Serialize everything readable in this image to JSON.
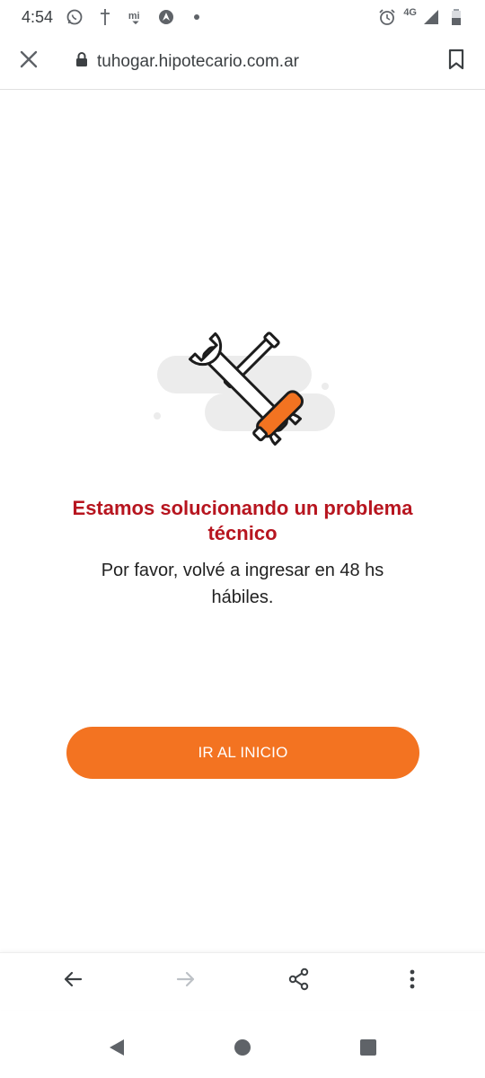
{
  "status_bar": {
    "time": "4:54",
    "icons": [
      "whatsapp-icon",
      "cross-icon",
      "mi-icon",
      "compass-icon",
      "dot-icon"
    ],
    "right_icons": [
      "alarm-icon",
      "signal-icon",
      "battery-icon"
    ],
    "network": "4G"
  },
  "toolbar": {
    "url": "tuhogar.hipotecario.com.ar",
    "close_icon": "close-icon",
    "lock_icon": "lock-icon",
    "bookmark_icon": "bookmark-icon"
  },
  "content": {
    "title": "Estamos solucionando un problema técnico",
    "message": "Por favor, volvé a ingresar en 48 hs hábiles.",
    "button_label": "IR AL INICIO",
    "illustration": "tools-icon"
  },
  "colors": {
    "accent": "#f37321",
    "title_red": "#b7151f",
    "illustration_bg": "#ececec"
  },
  "bottom_bar": {
    "icons": [
      "back-arrow-icon",
      "forward-arrow-icon",
      "share-icon",
      "more-icon"
    ]
  },
  "nav_bar": {
    "icons": [
      "nav-back-icon",
      "nav-home-icon",
      "nav-recents-icon"
    ]
  }
}
